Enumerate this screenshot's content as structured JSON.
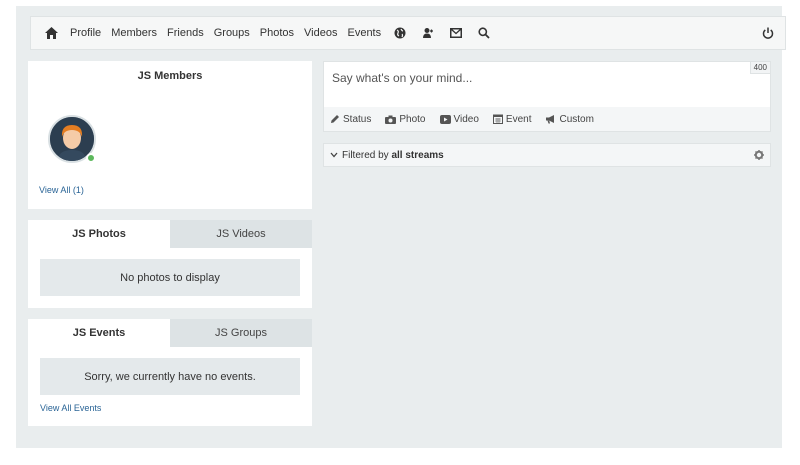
{
  "nav": {
    "items": [
      "Profile",
      "Members",
      "Friends",
      "Groups",
      "Photos",
      "Videos",
      "Events"
    ]
  },
  "members": {
    "title": "JS Members",
    "view_all": "View All (1)"
  },
  "photos_panel": {
    "tabs": [
      "JS Photos",
      "JS Videos"
    ],
    "empty": "No photos to display"
  },
  "events_panel": {
    "tabs": [
      "JS Events",
      "JS Groups"
    ],
    "empty": "Sorry, we currently have no events.",
    "view_all": "View All Events"
  },
  "composer": {
    "placeholder": "Say what's on your mind...",
    "char_count": "400",
    "actions": [
      "Status",
      "Photo",
      "Video",
      "Event",
      "Custom"
    ]
  },
  "filter": {
    "prefix": "Filtered by",
    "value": "all streams"
  },
  "colors": {
    "background": "#e9edee",
    "link": "#2a6496",
    "online": "#5cb85c",
    "inactive_tab": "#dde3e5"
  }
}
